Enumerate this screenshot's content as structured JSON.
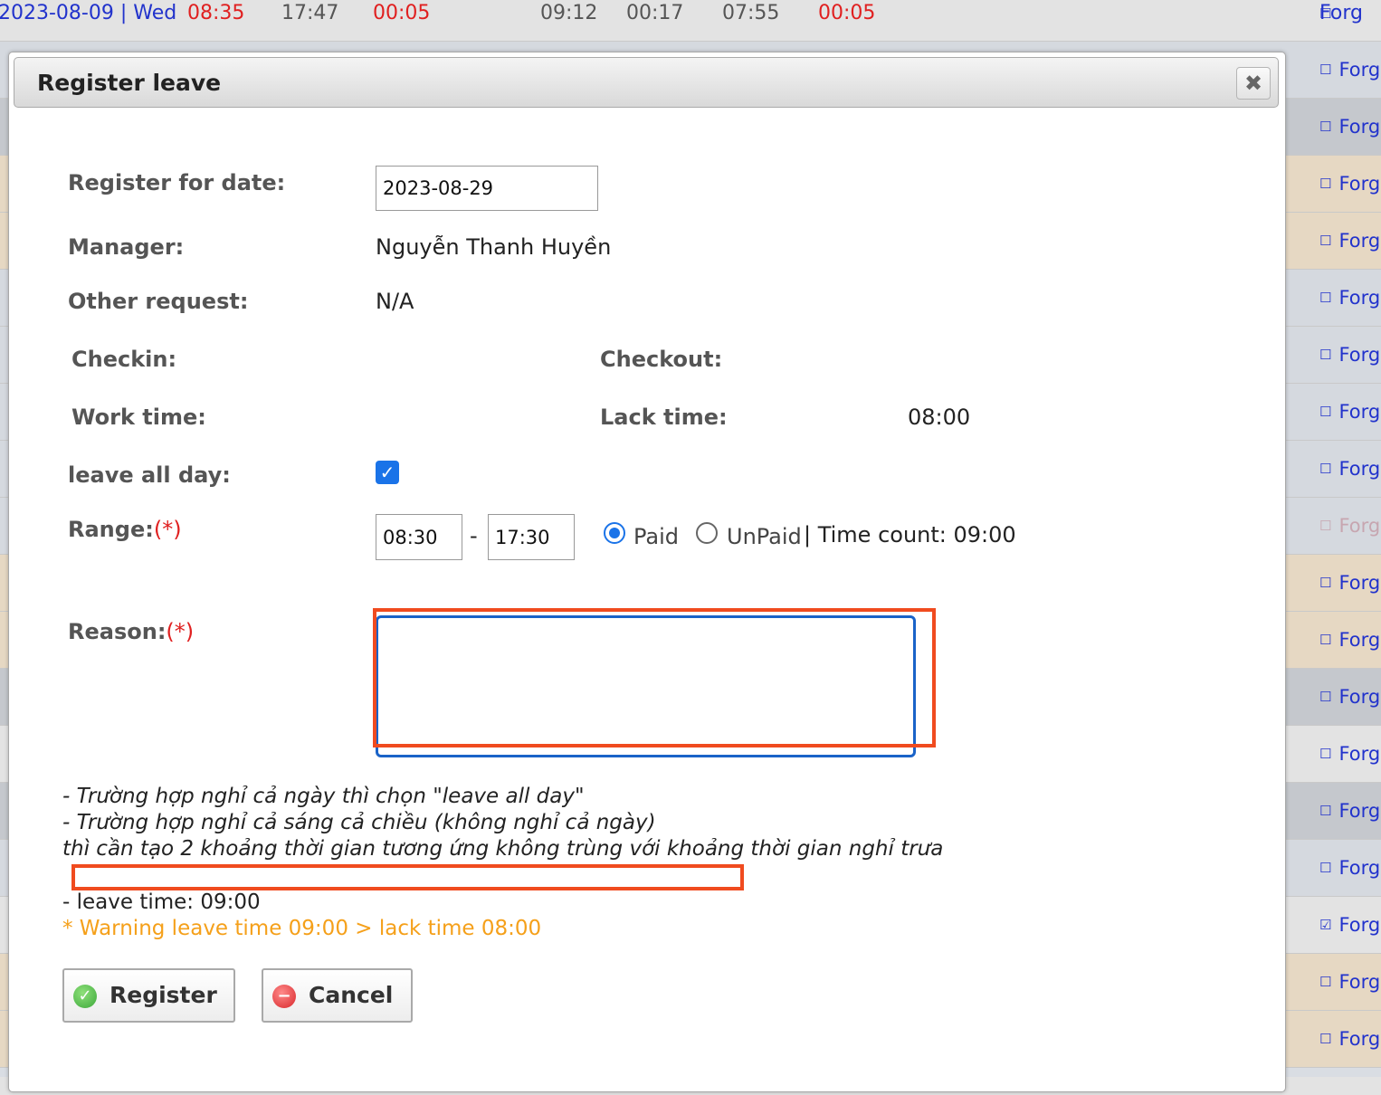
{
  "background": {
    "top_row": {
      "date": "2023-08-09 | Wed",
      "c1": "08:35",
      "c2": "17:47",
      "c3": "00:05",
      "c4": "09:12",
      "c5": "00:17",
      "c6": "07:55",
      "c7": "00:05"
    },
    "forgot_label": "Forg",
    "row_colors": [
      "#d5d9df",
      "#c5c8cd",
      "#e6d8c3",
      "#e6d8c3",
      "#d5d9df",
      "#d5d9df",
      "#d5d9df",
      "#d5d9df",
      "#d5d9df",
      "#e6d8c3",
      "#e6d8c3",
      "#c5c8cd",
      "#e3e3e3",
      "#c5c8cd",
      "#d5d9df",
      "#e3e3e3",
      "#e6d8c3",
      "#e6d8c3"
    ]
  },
  "dialog": {
    "title": "Register leave",
    "close_icon": "close-icon",
    "register_for_date_label": "Register for date:",
    "register_for_date_value": "2023-08-29",
    "manager_label": "Manager:",
    "manager_value": "Nguyễn Thanh Huyền",
    "other_request_label": "Other request:",
    "other_request_value": "N/A",
    "checkin_label": "Checkin:",
    "checkout_label": "Checkout:",
    "work_time_label": "Work time:",
    "lack_time_label": "Lack time:",
    "lack_time_value": "08:00",
    "leave_all_day_label": "leave all day:",
    "leave_all_day_checked": true,
    "range_label": "Range:",
    "required_mark": "(*)",
    "range_from": "08:30",
    "range_separator": "-",
    "range_to": "17:30",
    "paid_label": "Paid",
    "unpaid_label": "UnPaid",
    "time_count_text": "| Time count: 09:00",
    "reason_label": "Reason:",
    "reason_value": "",
    "note_line1": "- Trường hợp nghỉ cả ngày thì chọn \"leave all day\"",
    "note_line2": "- Trường hợp nghỉ cả sáng cả chiều (không nghỉ cả ngày)",
    "note_line3": "thì cần tạo 2 khoảng thời gian tương ứng không trùng với khoảng thời gian nghỉ trưa",
    "leave_time_text": "- leave time: 09:00",
    "warning_text": "* Warning leave time 09:00 > lack time 08:00",
    "register_button": "Register",
    "cancel_button": "Cancel",
    "annotation_color": "#f04b1f",
    "warning_color": "#f5a01a",
    "accent_color": "#1a73e8"
  }
}
